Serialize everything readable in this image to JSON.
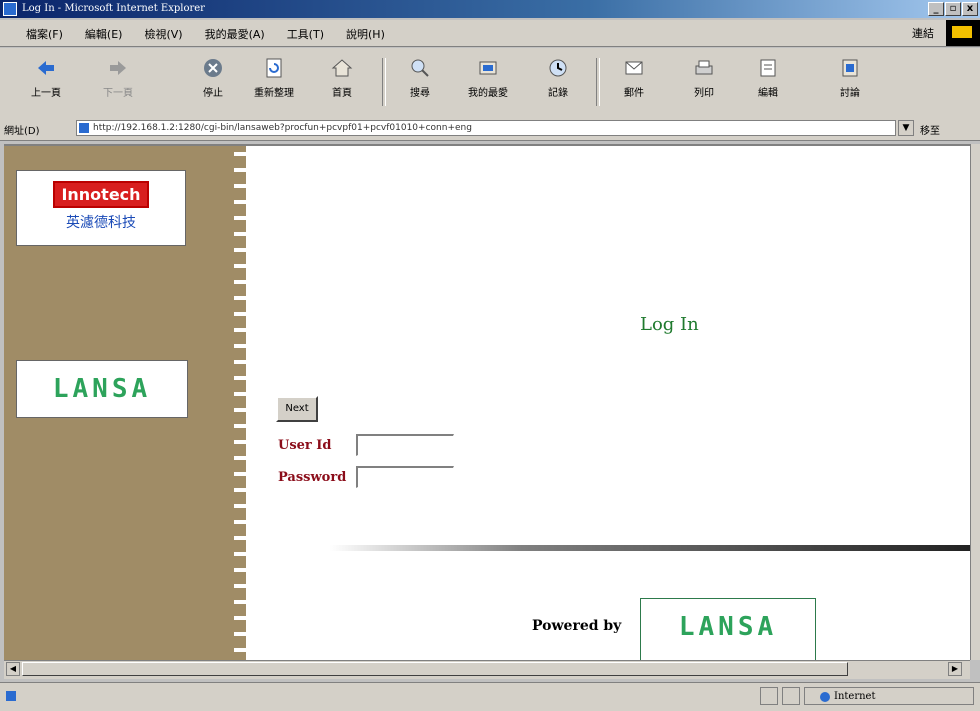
{
  "window": {
    "title": "Log In - Microsoft Internet Explorer",
    "controls": [
      "_",
      "▫",
      "x"
    ]
  },
  "menubar": {
    "items": [
      "檔案(F)",
      "編輯(E)",
      "檢視(V)",
      "我的最愛(A)",
      "工具(T)",
      "說明(H)"
    ],
    "links_label": "連結"
  },
  "toolbar": {
    "buttons": [
      {
        "label": "上一頁",
        "icon": "back-arrow-icon"
      },
      {
        "label": "下一頁",
        "icon": "forward-arrow-icon"
      },
      {
        "label": "停止",
        "icon": "stop-icon"
      },
      {
        "label": "重新整理",
        "icon": "refresh-icon"
      },
      {
        "label": "首頁",
        "icon": "home-icon"
      },
      {
        "label": "搜尋",
        "icon": "search-icon"
      },
      {
        "label": "我的最愛",
        "icon": "favorites-icon"
      },
      {
        "label": "記錄",
        "icon": "history-icon"
      },
      {
        "label": "郵件",
        "icon": "mail-icon"
      },
      {
        "label": "列印",
        "icon": "print-icon"
      },
      {
        "label": "編輯",
        "icon": "edit-icon"
      },
      {
        "label": "討論",
        "icon": "discuss-icon"
      }
    ]
  },
  "addressbar": {
    "label": "網址(D)",
    "url": "http://192.168.1.2:1280/cgi-bin/lansaweb?procfun+pcvpf01+pcvf01010+conn+eng",
    "go_label": "移至"
  },
  "page": {
    "sidebar_logo_text": "Innotech",
    "sidebar_logo_chinese": "英濾德科技",
    "sidebar_lansa_logo": "LANSA",
    "login_title": "Log In",
    "next_button": "Next",
    "user_id_label": "User Id",
    "password_label": "Password",
    "user_id_value": "",
    "password_value": "",
    "powered_by": "Powered by",
    "powered_logo": "LANSA"
  },
  "statusbar": {
    "zone_label": "Internet"
  }
}
